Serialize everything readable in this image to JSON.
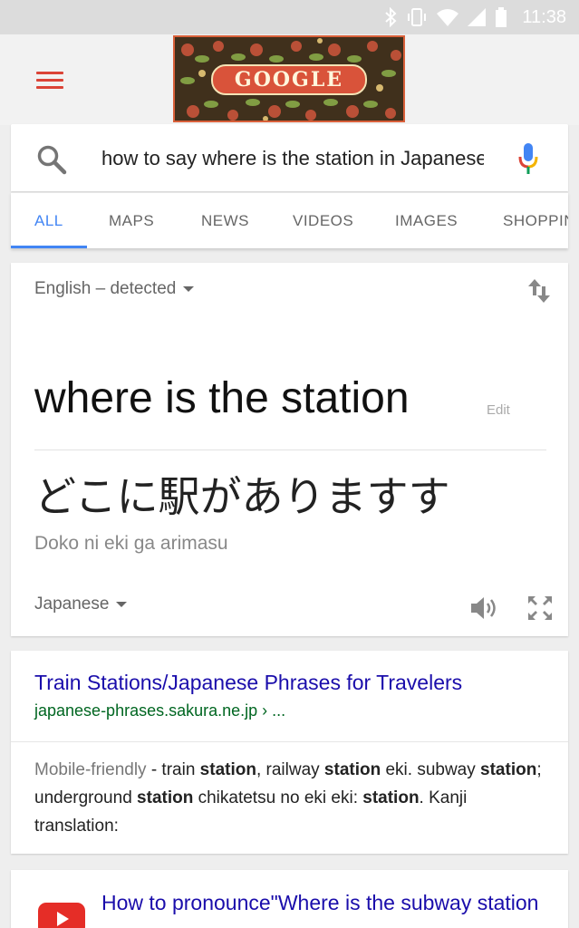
{
  "status_bar": {
    "time": "11:38",
    "icons": [
      "bluetooth-icon",
      "vibrate-icon",
      "wifi-icon",
      "signal-icon",
      "battery-icon"
    ]
  },
  "header": {
    "menu_icon": "hamburger-menu-icon",
    "doodle_text": "GOOGLE"
  },
  "search": {
    "query": "how to say where is the station in Japanese",
    "search_icon": "search-icon",
    "mic_icon": "microphone-icon"
  },
  "tabs": [
    {
      "label": "ALL",
      "active": true
    },
    {
      "label": "MAPS",
      "active": false
    },
    {
      "label": "NEWS",
      "active": false
    },
    {
      "label": "VIDEOS",
      "active": false
    },
    {
      "label": "IMAGES",
      "active": false
    },
    {
      "label": "SHOPPING",
      "active": false
    }
  ],
  "translate": {
    "source_language": "English – detected",
    "source_text": "where is the station",
    "edit_label": "Edit",
    "translated_text": "どこに駅がありますす",
    "romanization": "Doko ni eki ga arimasu",
    "target_language": "Japanese"
  },
  "result": {
    "title": "Train Stations/Japanese Phrases for Travelers",
    "url": "japanese-phrases.sakura.ne.jp › ...",
    "mobile_friendly": "Mobile-friendly",
    "snippet_parts": [
      " - train ",
      "station",
      ", railway ",
      "station",
      " eki. subway ",
      "station",
      "; underground ",
      "station",
      " chikatetsu no eki eki: ",
      "station",
      ". Kanji translation:"
    ]
  },
  "next_result": {
    "title": "How to pronounce\"Where is the subway station",
    "icon": "youtube-icon"
  },
  "colors": {
    "accent_blue": "#4285f4",
    "link_blue": "#1a0dab",
    "url_green": "#006621",
    "menu_red": "#db4437"
  }
}
